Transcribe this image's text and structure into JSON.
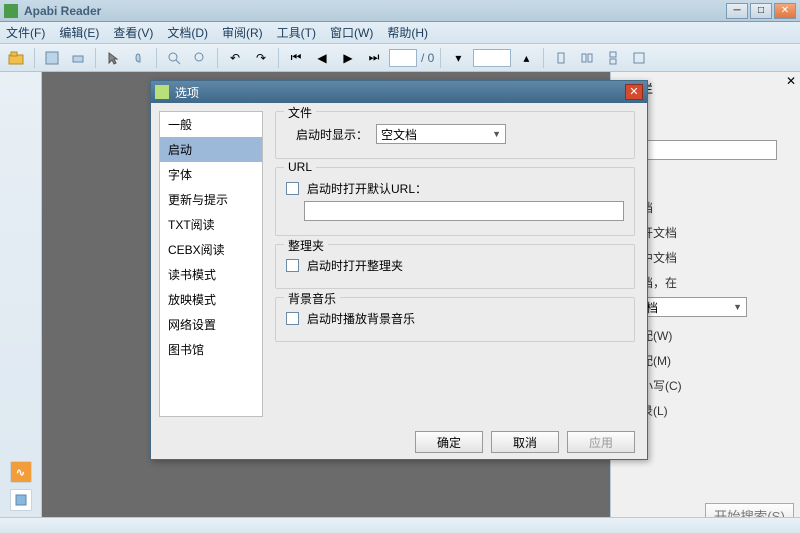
{
  "app": {
    "title": "Apabi Reader"
  },
  "menu": {
    "file": "文件(F)",
    "edit": "编辑(E)",
    "view": "查看(V)",
    "doc": "文档(D)",
    "review": "审阅(R)",
    "tool": "工具(T)",
    "window": "窗口(W)",
    "help": "帮助(H)"
  },
  "toolbar": {
    "page_sep": "/ 0"
  },
  "right_panel": {
    "title": "搜索栏",
    "label_content": "容：",
    "label_pos": "置：",
    "items": [
      "前文档",
      "有打开文档",
      "理夹中文档",
      "前文档，在"
    ],
    "dropdown": "的文档",
    "opt_match_case": "距匹配(W)",
    "opt_match_word": "词匹配(M)",
    "opt_case": "分大小写(C)",
    "opt_toc": "含目录(L)",
    "search_btn": "开始搜索(S)"
  },
  "dialog": {
    "title": "选项",
    "nav": [
      "一般",
      "启动",
      "字体",
      "更新与提示",
      "TXT阅读",
      "CEBX阅读",
      "读书模式",
      "放映模式",
      "网络设置",
      "图书馆"
    ],
    "nav_selected": 1,
    "file_group": "文件",
    "startup_show": "启动时显示：",
    "startup_show_value": "空文档",
    "url_group": "URL",
    "open_url": "启动时打开默认URL：",
    "url_value": "",
    "org_group": "整理夹",
    "open_org": "启动时打开整理夹",
    "music_group": "背景音乐",
    "play_music": "启动时播放背景音乐",
    "ok": "确定",
    "cancel": "取消",
    "apply": "应用"
  }
}
